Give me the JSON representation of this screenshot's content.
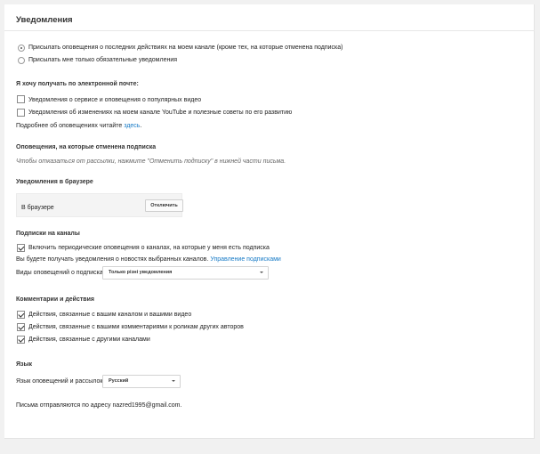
{
  "header": {
    "title": "Уведомления"
  },
  "activity": {
    "options": [
      {
        "label": "Присылать оповещения о последних действиях на моем канале (кроме тех, на которые отменена подписка)",
        "selected": true
      },
      {
        "label": "Присылать мне только обязательные уведомления",
        "selected": false
      }
    ]
  },
  "email": {
    "heading": "Я хочу получать по электронной почте:",
    "options": [
      {
        "label": "Уведомления о сервисе и оповещения о популярных видео",
        "checked": false
      },
      {
        "label": "Уведомления об изменениях на моем канале YouTube и полезные советы по его развитию",
        "checked": false
      }
    ],
    "more_prefix": "Подробнее об оповещениях читайте",
    "more_link": "здесь",
    "more_suffix": "."
  },
  "unsubscribed": {
    "heading": "Оповещения, на которые отменена подписка",
    "hint": "Чтобы отказаться от рассылки, нажмите \"Отменить подписку\" в нижней части письма."
  },
  "browser": {
    "heading": "Уведомления в браузере",
    "label": "В браузере",
    "button": "Отключить"
  },
  "subscriptions": {
    "heading": "Подписки на каналы",
    "checkbox": {
      "label": "Включить периодические оповещения о каналах, на которые у меня есть подписка",
      "checked": true
    },
    "info": "Вы будете получать уведомления о новостях выбранных каналов.",
    "manage_link": "Управление подписками",
    "type_label": "Виды оповещений о подписках",
    "type_value": "Только різні уведомления"
  },
  "comments": {
    "heading": "Комментарии и действия",
    "options": [
      {
        "label": "Действия, связанные с вашим каналом и вашими видео",
        "checked": true
      },
      {
        "label": "Действия, связанные с вашими комментариями к роликам других авторов",
        "checked": true
      },
      {
        "label": "Действия, связанные с другими каналами",
        "checked": true
      }
    ]
  },
  "language": {
    "heading": "Язык",
    "label": "Язык оповещений и рассылок:",
    "value": "Русский"
  },
  "footer": {
    "note": "Письма отправляются по адресу nazred1995@gmail.com."
  },
  "colors": {
    "link": "#167ac6",
    "background": "#f1f1f1"
  },
  "icons": {
    "radio": "radio-button",
    "checkbox": "checkbox",
    "select": "chevron-down-icon"
  }
}
